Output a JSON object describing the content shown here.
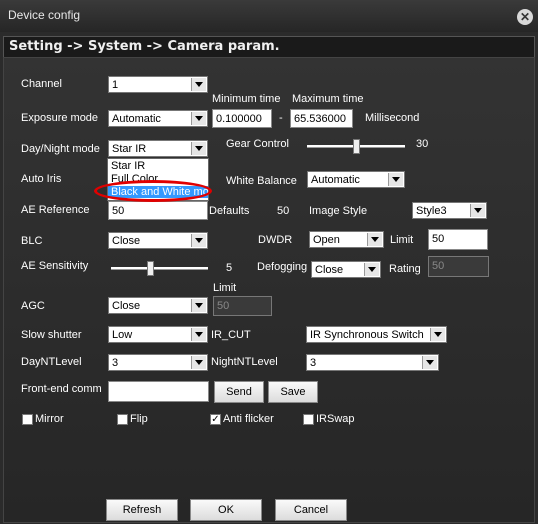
{
  "window": {
    "title": "Device config"
  },
  "header": {
    "breadcrumb": "Setting -> System -> Camera param."
  },
  "fields": {
    "channel": {
      "label": "Channel",
      "value": "1"
    },
    "exposure_mode": {
      "label": "Exposure mode",
      "value": "Automatic"
    },
    "min_time": {
      "label": "Minimum time",
      "value": "0.100000"
    },
    "max_time": {
      "label": "Maximum time",
      "value": "65.536000"
    },
    "time_sep": "-",
    "time_unit": "Millisecond",
    "day_night": {
      "label": "Day/Night mode",
      "value": "Star IR",
      "options": [
        "Star IR",
        "Full Color",
        "Black and White mode"
      ],
      "highlight_index": 2
    },
    "gear_control": {
      "label": "Gear Control",
      "value": "30",
      "level": 0.5
    },
    "auto_iris": {
      "label": "Auto Iris"
    },
    "white_balance": {
      "label": "White Balance",
      "value": "Automatic"
    },
    "ae_reference": {
      "label": "AE Reference",
      "value": "50"
    },
    "defaults": {
      "label": "Defaults",
      "value": "50"
    },
    "image_style": {
      "label": "Image Style",
      "value": "Style3"
    },
    "blc": {
      "label": "BLC",
      "value": "Close"
    },
    "dwdr": {
      "label": "DWDR",
      "value": "Open"
    },
    "limit1": {
      "label": "Limit",
      "value": "50"
    },
    "ae_sensitivity": {
      "label": "AE Sensitivity",
      "value": "5",
      "level": 0.4
    },
    "defogging": {
      "label": "Defogging",
      "value": "Close"
    },
    "rating": {
      "label": "Rating",
      "value": "50"
    },
    "agc": {
      "label": "AGC",
      "value": "Close"
    },
    "limit2": {
      "label": "Limit",
      "value": "50"
    },
    "slow_shutter": {
      "label": "Slow shutter",
      "value": "Low"
    },
    "ir_cut": {
      "label": "IR_CUT",
      "value": "IR Synchronous Switch"
    },
    "day_nt_level": {
      "label": "DayNTLevel",
      "value": "3"
    },
    "night_nt_level": {
      "label": "NightNTLevel",
      "value": "3"
    },
    "front_end": {
      "label": "Front-end comm",
      "value": ""
    }
  },
  "buttons": {
    "send": "Send",
    "save": "Save",
    "refresh": "Refresh",
    "ok": "OK",
    "cancel": "Cancel"
  },
  "checkboxes": {
    "mirror": {
      "label": "Mirror",
      "checked": false
    },
    "flip": {
      "label": "Flip",
      "checked": false
    },
    "anti_flicker": {
      "label": "Anti flicker",
      "checked": true
    },
    "irswap": {
      "label": "IRSwap",
      "checked": false
    }
  },
  "colors": {
    "annotation": "#e00000",
    "highlight": "#3399ff"
  }
}
